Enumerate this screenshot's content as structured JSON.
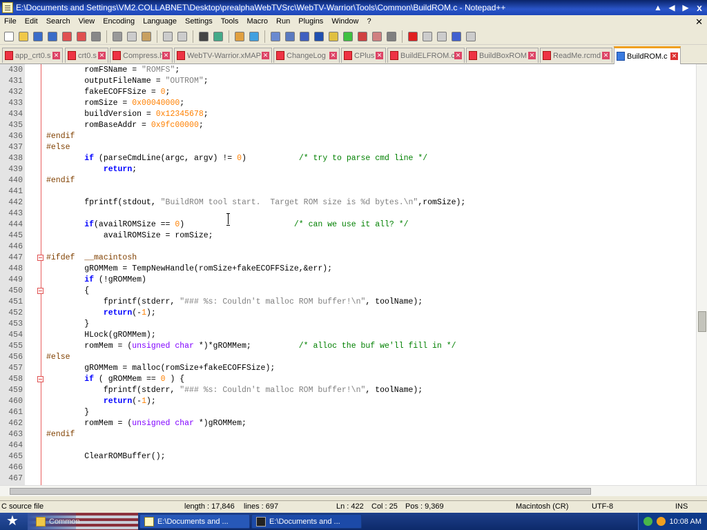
{
  "window": {
    "title": "E:\\Documents and Settings\\VM2.COLLABNET\\Desktop\\prealphaWebTVSrc\\WebTV-Warrior\\Tools\\Common\\BuildROM.c - Notepad++",
    "close_glyph": "x"
  },
  "menu": [
    "File",
    "Edit",
    "Search",
    "View",
    "Encoding",
    "Language",
    "Settings",
    "Tools",
    "Macro",
    "Run",
    "Plugins",
    "Window",
    "?"
  ],
  "tabs": [
    {
      "label": "app_crt0.s",
      "active": false
    },
    {
      "label": "crt0.s",
      "active": false
    },
    {
      "label": "Compress.h",
      "active": false
    },
    {
      "label": "WebTV-Warrior.xMAP",
      "active": false
    },
    {
      "label": "ChangeLog",
      "active": false
    },
    {
      "label": "CPlus",
      "active": false
    },
    {
      "label": "BuildELFROM.c",
      "active": false
    },
    {
      "label": "BuildBoxROM",
      "active": false
    },
    {
      "label": "ReadMe.rcmd",
      "active": false
    },
    {
      "label": "BuildROM.c",
      "active": true
    }
  ],
  "code": [
    {
      "n": "430",
      "fold": false,
      "t": "        romFSName = <s>\"ROMFS\"</s>;"
    },
    {
      "n": "431",
      "fold": false,
      "t": "        outputFileName = <s>\"OUTROM\"</s>;"
    },
    {
      "n": "432",
      "fold": false,
      "t": "        fakeECOFFSize = <n>0</n>;"
    },
    {
      "n": "433",
      "fold": false,
      "t": "        romSize = <n>0x00040000</n>;"
    },
    {
      "n": "434",
      "fold": false,
      "t": "        buildVersion = <n>0x12345678</n>;"
    },
    {
      "n": "435",
      "fold": false,
      "t": "        romBaseAddr = <n>0x9fc00000</n>;"
    },
    {
      "n": "436",
      "fold": false,
      "t": "<p>#endif</p>"
    },
    {
      "n": "437",
      "fold": false,
      "t": "<p>#else</p>"
    },
    {
      "n": "438",
      "fold": false,
      "t": "        <k>if</k> (parseCmdLine(argc, argv) != <n>0</n>)           <c>/* try to parse cmd line */</c>"
    },
    {
      "n": "439",
      "fold": false,
      "t": "            <k>return</k>;"
    },
    {
      "n": "440",
      "fold": false,
      "t": "<p>#endif</p>"
    },
    {
      "n": "441",
      "fold": false,
      "t": ""
    },
    {
      "n": "442",
      "fold": false,
      "t": "        fprintf(stdout, <s>\"BuildROM tool start.  Target ROM size is %d bytes.\\n\"</s>,romSize);"
    },
    {
      "n": "443",
      "fold": false,
      "t": ""
    },
    {
      "n": "444",
      "fold": false,
      "t": "        <k>if</k>(availROMSize == <n>0</n>)                       <c>/* can we use it all? */</c>"
    },
    {
      "n": "445",
      "fold": false,
      "t": "            availROMSize = romSize;"
    },
    {
      "n": "446",
      "fold": false,
      "t": ""
    },
    {
      "n": "447",
      "fold": true,
      "t": "<p>#ifdef  __macintosh</p>"
    },
    {
      "n": "448",
      "fold": false,
      "t": "        gROMMem = TempNewHandle(romSize+fakeECOFFSize,&err);"
    },
    {
      "n": "449",
      "fold": false,
      "t": "        <k>if</k> (!gROMMem)"
    },
    {
      "n": "450",
      "fold": true,
      "t": "        {"
    },
    {
      "n": "451",
      "fold": false,
      "t": "            fprintf(stderr, <s>\"### %s: Couldn't malloc ROM buffer!\\n\"</s>, toolName);"
    },
    {
      "n": "452",
      "fold": false,
      "t": "            <k>return</k>(-<n>1</n>);"
    },
    {
      "n": "453",
      "fold": false,
      "t": "        }"
    },
    {
      "n": "454",
      "fold": false,
      "t": "        HLock(gROMMem);"
    },
    {
      "n": "455",
      "fold": false,
      "t": "        romMem = (<y>unsigned char</y> *)*gROMMem;          <c>/* alloc the buf we'll fill in */</c>"
    },
    {
      "n": "456",
      "fold": false,
      "t": "<p>#else</p>"
    },
    {
      "n": "457",
      "fold": false,
      "t": "        gROMMem = malloc(romSize+fakeECOFFSize);"
    },
    {
      "n": "458",
      "fold": true,
      "t": "        <k>if</k> ( gROMMem == <n>0</n> ) {"
    },
    {
      "n": "459",
      "fold": false,
      "t": "            fprintf(stderr, <s>\"### %s: Couldn't malloc ROM buffer!\\n\"</s>, toolName);"
    },
    {
      "n": "460",
      "fold": false,
      "t": "            <k>return</k>(-<n>1</n>);"
    },
    {
      "n": "461",
      "fold": false,
      "t": "        }"
    },
    {
      "n": "462",
      "fold": false,
      "t": "        romMem = (<y>unsigned char</y> *)gROMMem;"
    },
    {
      "n": "463",
      "fold": false,
      "t": "<p>#endif</p>"
    },
    {
      "n": "464",
      "fold": false,
      "t": ""
    },
    {
      "n": "465",
      "fold": false,
      "t": "        ClearROMBuffer();"
    },
    {
      "n": "466",
      "fold": false,
      "t": ""
    },
    {
      "n": "467",
      "fold": false,
      "t": ""
    }
  ],
  "status": {
    "file_type": "C source file",
    "length": "length : 17,846",
    "lines": "lines : 697",
    "ln": "Ln : 422",
    "col": "Col : 25",
    "pos": "Pos : 9,369",
    "eol": "Macintosh (CR)",
    "encoding": "UTF-8",
    "mode": "INS"
  },
  "taskbar": {
    "folder_btn": "Common",
    "task1": "E:\\Documents and ...",
    "task2": "E:\\Documents and ...",
    "clock": "10:08 AM"
  },
  "colors": {
    "keyword": "#0000ff",
    "string": "#808080",
    "number": "#ff8000",
    "comment": "#008000",
    "preprocessor": "#804000",
    "active_tab_accent": "#f0a020"
  }
}
